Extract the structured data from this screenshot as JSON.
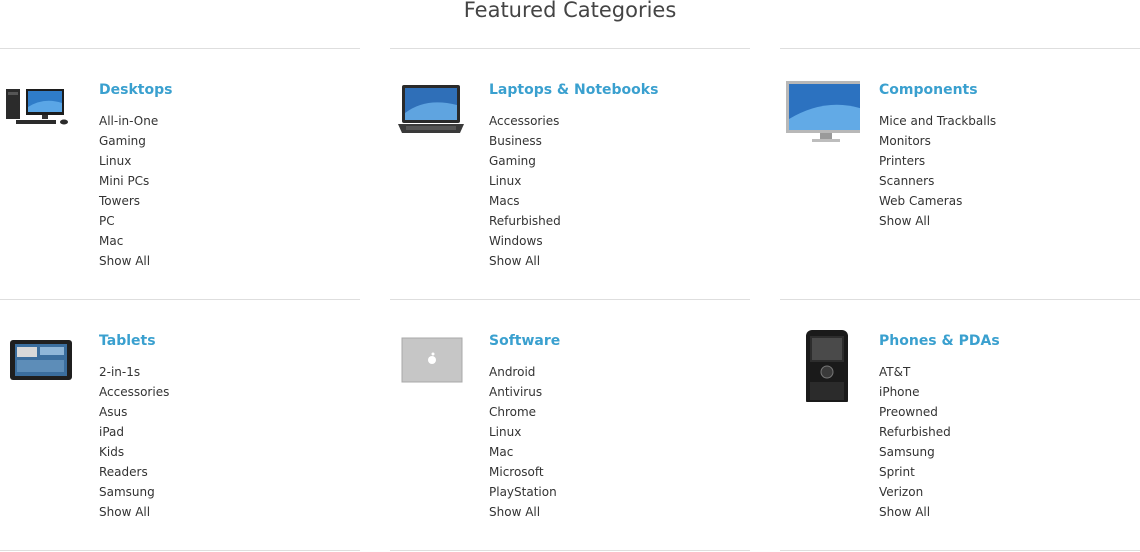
{
  "section": {
    "title": "Featured Categories"
  },
  "categories": [
    {
      "title": "Desktops",
      "icon": "desktop-computer-image",
      "items": [
        "All-in-One",
        "Gaming",
        "Linux",
        "Mini PCs",
        "Towers",
        "PC",
        "Mac"
      ],
      "show_all": "Show All"
    },
    {
      "title": "Laptops & Notebooks",
      "icon": "laptop-image",
      "items": [
        "Accessories",
        "Business",
        "Gaming",
        "Linux",
        "Macs",
        "Refurbished",
        "Windows"
      ],
      "show_all": "Show All"
    },
    {
      "title": "Components",
      "icon": "monitor-image",
      "items": [
        "Mice and Trackballs",
        "Monitors",
        "Printers",
        "Scanners",
        "Web Cameras"
      ],
      "show_all": "Show All"
    },
    {
      "title": "Tablets",
      "icon": "tablet-image",
      "items": [
        "2-in-1s",
        "Accessories",
        "Asus",
        "iPad",
        "Kids",
        "Readers",
        "Samsung"
      ],
      "show_all": "Show All"
    },
    {
      "title": "Software",
      "icon": "software-box-image",
      "items": [
        "Android",
        "Antivirus",
        "Chrome",
        "Linux",
        "Mac",
        "Microsoft",
        "PlayStation"
      ],
      "show_all": "Show All"
    },
    {
      "title": "Phones & PDAs",
      "icon": "smartphone-image",
      "items": [
        "AT&T",
        "iPhone",
        "Preowned",
        "Refurbished",
        "Samsung",
        "Sprint",
        "Verizon"
      ],
      "show_all": "Show All"
    }
  ],
  "colors": {
    "link_accent": "#3aa0cf",
    "text": "#333333",
    "divider": "#dedede"
  }
}
